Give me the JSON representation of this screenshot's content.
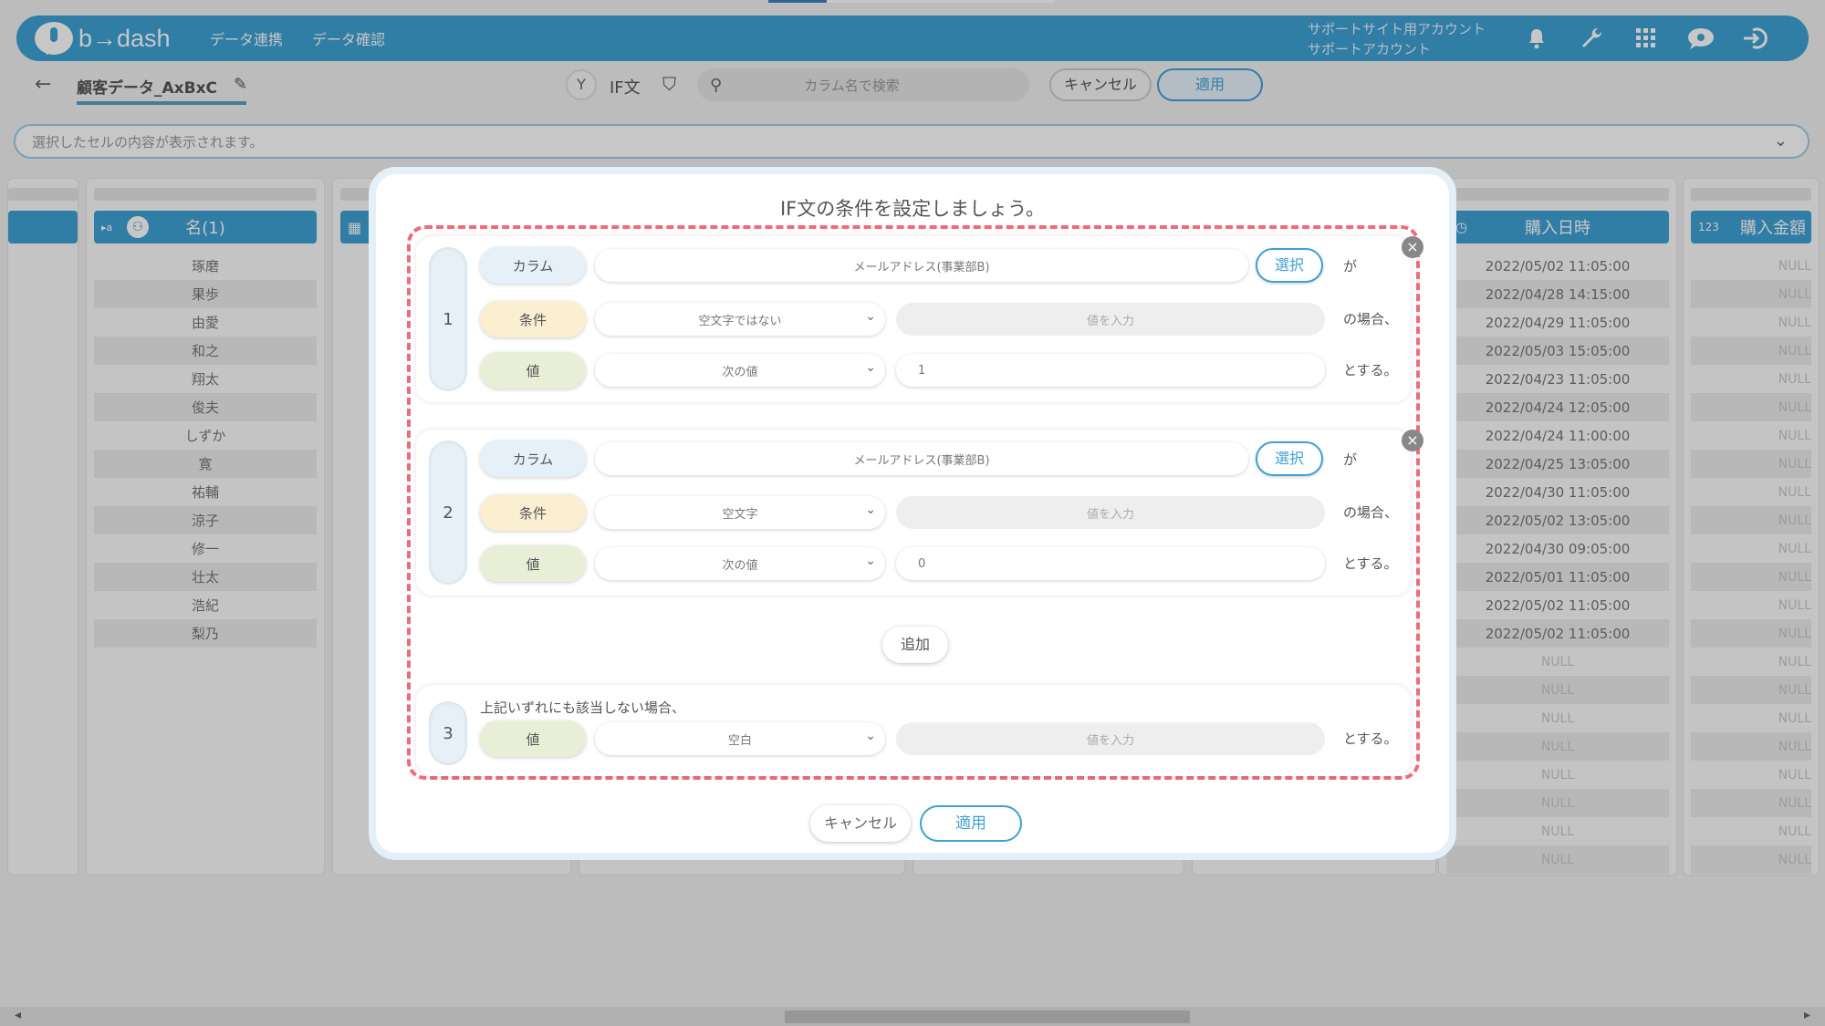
{
  "header": {
    "logo_text": "b→dash",
    "nav": [
      "データ連携",
      "データ確認"
    ],
    "account_line1": "サポートサイト用アカウント",
    "account_line2": "サポートアカウント"
  },
  "subheader": {
    "doc_name": "顧客データ_AxBxC",
    "mode_label": "IF文",
    "search_placeholder": "カラム名で検索",
    "cancel_label": "キャンセル",
    "apply_label": "適用"
  },
  "cellbar": {
    "placeholder": "選択したセルの内容が表示されます。"
  },
  "table": {
    "name_header": "名(1)",
    "name_type": "a",
    "names": [
      "琢磨",
      "果歩",
      "由愛",
      "和之",
      "翔太",
      "俊夫",
      "しずか",
      "寛",
      "祐輔",
      "涼子",
      "修一",
      "壮太",
      "浩紀",
      "梨乃"
    ],
    "date_header": "購入日時",
    "dates": [
      "2022/05/02 11:05:00",
      "2022/04/28 14:15:00",
      "2022/04/29 11:05:00",
      "2022/05/03 15:05:00",
      "2022/04/23 11:05:00",
      "2022/04/24 12:05:00",
      "2022/04/24 11:00:00",
      "2022/04/25 13:05:00",
      "2022/04/30 11:05:00",
      "2022/05/02 13:05:00",
      "2022/04/30 09:05:00",
      "2022/05/01 11:05:00",
      "2022/05/02 11:05:00",
      "2022/05/02 11:05:00"
    ],
    "amount_header": "購入金額",
    "amount_type": "123",
    "null_text": "NULL"
  },
  "modal": {
    "title": "IF文の条件を設定しましょう。",
    "column_label": "カラム",
    "condition_label": "条件",
    "value_label": "値",
    "choose_label": "選択",
    "value_placeholder": "値を入力",
    "suffix_ga": "が",
    "suffix_case": "の場合、",
    "suffix_suru": "とする。",
    "rules": [
      {
        "number": "1",
        "column": "メールアドレス(事業部B)",
        "condition": "空文字ではない",
        "value_type": "次の値",
        "value": "1"
      },
      {
        "number": "2",
        "column": "メールアドレス(事業部B)",
        "condition": "空文字",
        "value_type": "次の値",
        "value": "0"
      }
    ],
    "add_label": "追加",
    "else_rule": {
      "number": "3",
      "text": "上記いずれにも該当しない場合、",
      "value_type": "空白"
    },
    "cancel_label": "キャンセル",
    "apply_label": "適用"
  }
}
